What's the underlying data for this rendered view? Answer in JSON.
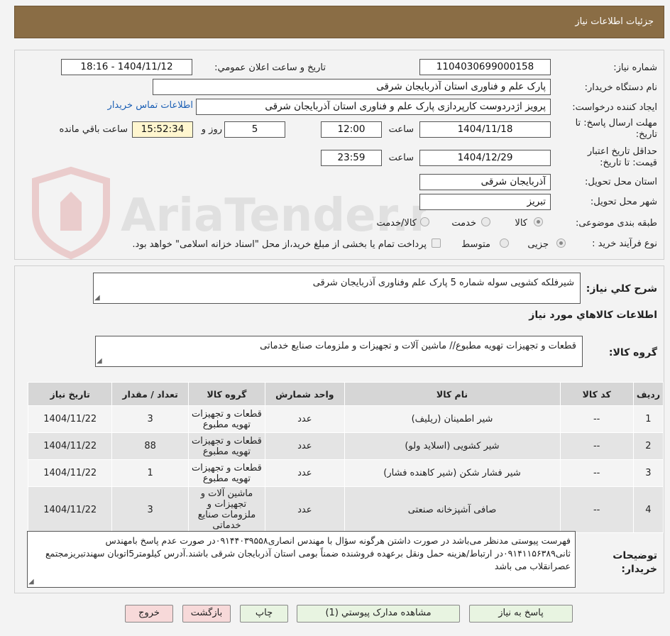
{
  "header": {
    "title": "جزئیات اطلاعات نیاز"
  },
  "form": {
    "need_number_label": "شماره نیاز:",
    "need_number": "1104030699000158",
    "announce_label": "تاریخ و ساعت اعلان عمومي:",
    "announce_value": "1404/11/12 - 18:16",
    "buyer_org_label": "نام دستگاه خریدار:",
    "buyer_org": "پارک علم و فناوری استان آذربایجان شرقی",
    "creator_label": "ایجاد کننده درخواست:",
    "creator": "پرویز اژدردوست کارپردازی پارک علم و فناوری استان آذربایجان شرقی",
    "contact_link": "اطلاعات تماس خریدار",
    "deadline_label": "مهلت ارسال پاسخ: تا تاریخ:",
    "deadline_date": "1404/11/18",
    "time_label": "ساعت",
    "deadline_time": "12:00",
    "days_value": "5",
    "days_label": "روز و",
    "remaining_time": "15:52:34",
    "remaining_label": "ساعت باقي مانده",
    "validity_label": "حداقل تاریخ اعتبار قیمت: تا تاریخ:",
    "validity_date": "1404/12/29",
    "validity_time": "23:59",
    "province_label": "استان محل تحویل:",
    "province": "آذربایجان شرقی",
    "city_label": "شهر محل تحویل:",
    "city": "تبریز",
    "category_label": "طبقه بندی موضوعی:",
    "category_options": [
      "کالا",
      "خدمت",
      "کالا/خدمت"
    ],
    "category_selected": "کالا",
    "process_label": "نوع فرآیند خرید :",
    "process_options": [
      "جزیی",
      "متوسط"
    ],
    "process_selected": "جزیی",
    "payment_note": "پرداخت تمام یا بخشی از مبلغ خرید،از محل \"اسناد خزانه اسلامی\" خواهد بود."
  },
  "watermark": {
    "text": "AriaTender.net"
  },
  "summary": {
    "label": "شرح کلي نیاز:",
    "text": "شیرفلکه کشویی سوله شماره 5 پارک علم وفناوری آذربایجان شرقی",
    "goods_info_title": "اطلاعات کالاهاي مورد نیاز",
    "goods_group_label": "گروه کالا:",
    "goods_group": "قطعات و تجهیزات تهویه مطبوع// ماشین آلات و تجهیزات و ملزومات صنایع خدماتی"
  },
  "table": {
    "headers": [
      "ردیف",
      "کد کالا",
      "نام کالا",
      "واحد شمارش",
      "گروه کالا",
      "تعداد / مقدار",
      "تاریخ نیاز"
    ],
    "rows": [
      {
        "n": "1",
        "code": "--",
        "name": "شیر اطمینان (ریلیف)",
        "unit": "عدد",
        "group": "قطعات و تجهیزات تهویه مطبوع",
        "qty": "3",
        "date": "1404/11/22"
      },
      {
        "n": "2",
        "code": "--",
        "name": "شیر کشویی (اسلاید ولو)",
        "unit": "عدد",
        "group": "قطعات و تجهیزات تهویه مطبوع",
        "qty": "88",
        "date": "1404/11/22"
      },
      {
        "n": "3",
        "code": "--",
        "name": "شیر فشار شکن (شیر کاهنده فشار)",
        "unit": "عدد",
        "group": "قطعات و تجهیزات تهویه مطبوع",
        "qty": "1",
        "date": "1404/11/22"
      },
      {
        "n": "4",
        "code": "--",
        "name": "صافی آشپزخانه صنعتی",
        "unit": "عدد",
        "group": "ماشین آلات و تجهیزات و ملزومات صنایع خدماتی",
        "qty": "3",
        "date": "1404/11/22"
      }
    ]
  },
  "notes": {
    "label": "توضیحات خریدار:",
    "text": "فهرست پیوستی مدنظر می‌باشد در صورت داشتن هرگونه سؤال با مهندس انصاری۰۹۱۴۴۰۳۹۵۵۸در صورت عدم پاسخ بامهندس ثانی۰۹۱۴۱۱۵۶۳۸۹در ارتباط/هزینه حمل ونقل برعهده فروشنده ضمناً بومی استان آذربایجان شرقی باشند.آدرس کیلومتر5اتوبان سهندتبریزمجتمع عصرانقلاب می باشد"
  },
  "buttons": {
    "reply": "پاسخ به نیاز",
    "attachments": "مشاهده مدارک پیوستي (1)",
    "print": "چاپ",
    "back": "بازگشت",
    "exit": "خروج"
  }
}
